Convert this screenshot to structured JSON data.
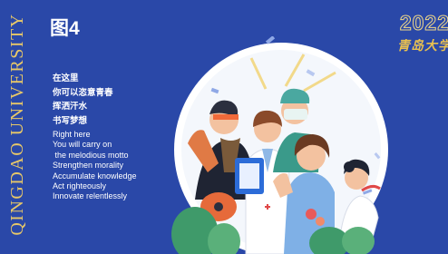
{
  "vertical_title": "QINGDAO UNIVERSITY",
  "figure_label": "图4",
  "year": "2022",
  "school_name": "青岛大学",
  "cn_lines": [
    "在这里",
    "你可以恣意青春",
    "挥洒汗水",
    "书写梦想"
  ],
  "en_lines": [
    "Right here",
    "You will carry on",
    " the melodious motto",
    "Strengthen morality",
    "Accumulate knowledge",
    "Act righteously",
    "Innovate relentlessly"
  ],
  "colors": {
    "background": "#2a48a8",
    "gold": "#e8c868",
    "circle": "#ffffff",
    "text": "#ffffff"
  }
}
